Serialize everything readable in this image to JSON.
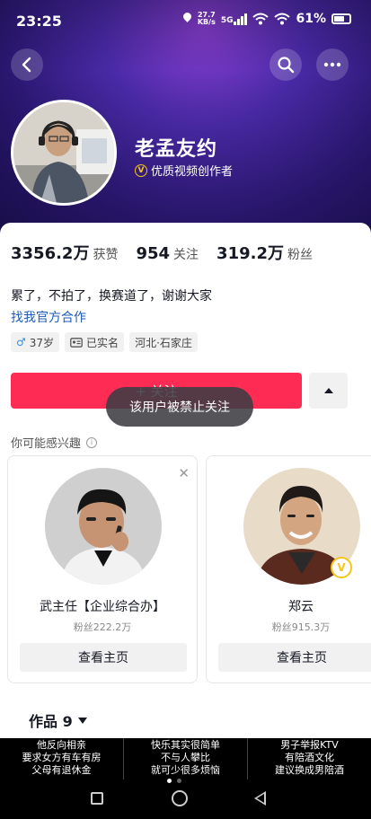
{
  "status_bar": {
    "time": "23:25",
    "net_speed_value": "27.7",
    "net_speed_unit": "KB/s",
    "network": "5G",
    "battery": "61%"
  },
  "header": {
    "username": "老孟友约",
    "creator_label": "优质视频创作者"
  },
  "stats": {
    "likes_value": "3356.2万",
    "likes_label": "获赞",
    "following_value": "954",
    "following_label": "关注",
    "followers_value": "319.2万",
    "followers_label": "粉丝"
  },
  "profile": {
    "bio": "累了，不拍了，换赛道了，谢谢大家",
    "business_link": "找我官方合作",
    "tags": {
      "age": "37岁",
      "verified": "已实名",
      "location": "河北·石家庄"
    }
  },
  "actions": {
    "follow_label": "+ 关注",
    "toast": "该用户被禁止关注"
  },
  "recommend": {
    "title": "你可能感兴趣",
    "cards": [
      {
        "name": "武主任【企业综合办】",
        "fans": "粉丝222.2万",
        "button": "查看主页"
      },
      {
        "name": "郑云",
        "fans": "粉丝915.3万",
        "button": "查看主页"
      }
    ]
  },
  "works": {
    "label": "作品 9"
  },
  "ads": [
    {
      "line1": "他反向相亲",
      "line2": "要求女方有车有房",
      "line3": "父母有退休金"
    },
    {
      "line1": "快乐其实很简单",
      "line2": "不与人攀比",
      "line3": "就可少很多烦恼"
    },
    {
      "line1": "男子举报KTV",
      "line2": "有陪酒文化",
      "line3": "建议换成男陪酒"
    }
  ],
  "colors": {
    "accent": "#fe2c55",
    "link": "#1c5bb8",
    "banner": "#3a1f8c"
  }
}
